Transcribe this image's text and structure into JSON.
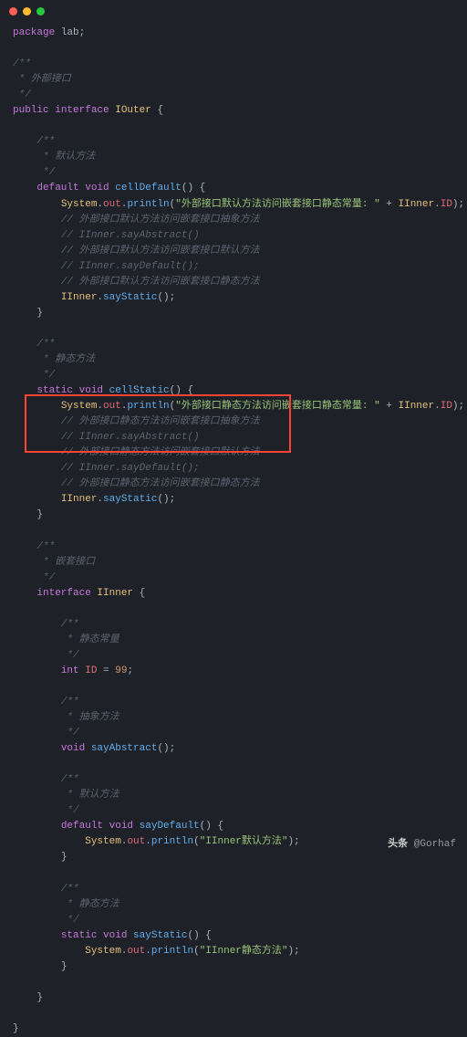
{
  "titlebar": {
    "red": "",
    "yellow": "",
    "green": ""
  },
  "code": {
    "l1_kw1": "package",
    "l1_id": " lab",
    "l1_p": ";",
    "c1a": "/**",
    "c1b": " * 外部接口",
    "c1c": " */",
    "l2_kw1": "public ",
    "l2_kw2": "interface ",
    "l2_cls": "IOuter",
    "l2_b": " {",
    "c2a": "/**",
    "c2b": " * 默认方法",
    "c2c": " */",
    "l3_kw1": "default ",
    "l3_kw2": "void ",
    "l3_fn": "cellDefault",
    "l3_p": "() {",
    "l4_cls": "System",
    "l4_d1": ".",
    "l4_f": "out",
    "l4_d2": ".",
    "l4_fn": "println",
    "l4_p1": "(",
    "l4_str": "\"外部接口默认方法访问嵌套接口静态常量: \"",
    "l4_p2": " + ",
    "l4_cls2": "IInner",
    "l4_d3": ".",
    "l4_id": "ID",
    "l4_p3": ");",
    "l5c": "// 外部接口默认方法访问嵌套接口抽象方法",
    "l6c": "// IInner.sayAbstract()",
    "l7c": "// 外部接口默认方法访问嵌套接口默认方法",
    "l8c": "// IInner.sayDefault();",
    "l9c": "// 外部接口默认方法访问嵌套接口静态方法",
    "l10_cls": "IInner",
    "l10_d": ".",
    "l10_fn": "sayStatic",
    "l10_p": "();",
    "l11_b": "}",
    "c3a": "/**",
    "c3b": " * 静态方法",
    "c3c": " */",
    "l12_kw1": "static ",
    "l12_kw2": "void ",
    "l12_fn": "cellStatic",
    "l12_p": "() {",
    "l13_cls": "System",
    "l13_d1": ".",
    "l13_f": "out",
    "l13_d2": ".",
    "l13_fn": "println",
    "l13_p1": "(",
    "l13_str": "\"外部接口静态方法访问嵌套接口静态常量: \"",
    "l13_p2": " + ",
    "l13_cls2": "IInner",
    "l13_d3": ".",
    "l13_id": "ID",
    "l13_p3": ");",
    "l14c": "// 外部接口静态方法访问嵌套接口抽象方法",
    "l15c": "// IInner.sayAbstract()",
    "l16c": "// 外部接口静态方法访问嵌套接口默认方法",
    "l17c": "// IInner.sayDefault();",
    "l18c": "// 外部接口静态方法访问嵌套接口静态方法",
    "l19_cls": "IInner",
    "l19_d": ".",
    "l19_fn": "sayStatic",
    "l19_p": "();",
    "l20_b": "}",
    "c4a": "/**",
    "c4b": " * 嵌套接口",
    "c4c": " */",
    "l21_kw": "interface ",
    "l21_cls": "IInner",
    "l21_b": " {",
    "c5a": "/**",
    "c5b": " * 静态常量",
    "c5c": " */",
    "l22_kw": "int ",
    "l22_id": "ID",
    "l22_eq": " = ",
    "l22_num": "99",
    "l22_p": ";",
    "c6a": "/**",
    "c6b": " * 抽象方法",
    "c6c": " */",
    "l23_kw": "void ",
    "l23_fn": "sayAbstract",
    "l23_p": "();",
    "c7a": "/**",
    "c7b": " * 默认方法",
    "c7c": " */",
    "l24_kw1": "default ",
    "l24_kw2": "void ",
    "l24_fn": "sayDefault",
    "l24_p": "() {",
    "l25_cls": "System",
    "l25_d1": ".",
    "l25_f": "out",
    "l25_d2": ".",
    "l25_fn": "println",
    "l25_p1": "(",
    "l25_str": "\"IInner默认方法\"",
    "l25_p2": ");",
    "l26_b": "}",
    "c8a": "/**",
    "c8b": " * 静态方法",
    "c8c": " */",
    "l27_kw1": "static ",
    "l27_kw2": "void ",
    "l27_fn": "sayStatic",
    "l27_p": "() {",
    "l28_cls": "System",
    "l28_d1": ".",
    "l28_f": "out",
    "l28_d2": ".",
    "l28_fn": "println",
    "l28_p1": "(",
    "l28_str": "\"IInner静态方法\"",
    "l28_p2": ");",
    "l29_b": "}",
    "l30_b": "}",
    "l31_b": "}"
  },
  "watermark": {
    "prefix": "头条 ",
    "author": "@Gorhaf"
  }
}
